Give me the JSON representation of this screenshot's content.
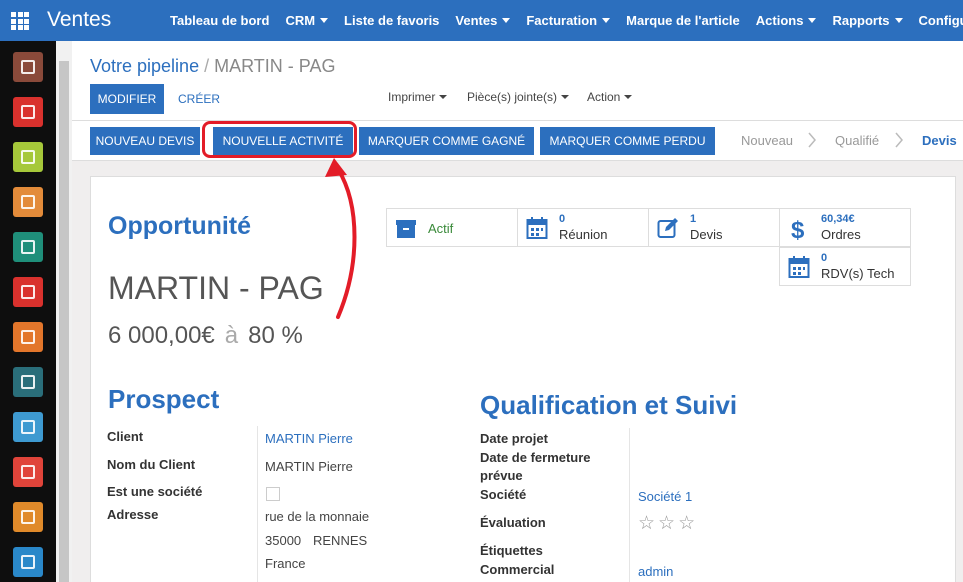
{
  "app": {
    "title": "Ventes"
  },
  "menu": [
    {
      "label": "Tableau de bord",
      "caret": false
    },
    {
      "label": "CRM",
      "caret": true
    },
    {
      "label": "Liste de favoris",
      "caret": false
    },
    {
      "label": "Ventes",
      "caret": true
    },
    {
      "label": "Facturation",
      "caret": true
    },
    {
      "label": "Marque de l'article",
      "caret": false
    },
    {
      "label": "Actions",
      "caret": true
    },
    {
      "label": "Rapports",
      "caret": true
    },
    {
      "label": "Configuration",
      "caret": false
    }
  ],
  "sidebar_apps": [
    {
      "icon": "discuss-icon",
      "color": "#8a4a3a"
    },
    {
      "icon": "mail-icon",
      "color": "#d9312d"
    },
    {
      "icon": "calendar-icon",
      "color": "#a6c83a"
    },
    {
      "icon": "location-pin-icon",
      "color": "#e38b3a"
    },
    {
      "icon": "contacts-icon",
      "color": "#1f8f7a"
    },
    {
      "icon": "folder-icon",
      "color": "#d9312d"
    },
    {
      "icon": "chart-icon",
      "color": "#e3762b"
    },
    {
      "icon": "spreadsheet-icon",
      "color": "#2a6e7a"
    },
    {
      "icon": "card-icon",
      "color": "#3e9ad1"
    },
    {
      "icon": "building-icon",
      "color": "#e0443a"
    },
    {
      "icon": "document-icon",
      "color": "#e08a2a"
    },
    {
      "icon": "puzzle-icon",
      "color": "#2a88c9"
    }
  ],
  "breadcrumb": {
    "parent": "Votre pipeline",
    "separator": "/",
    "current": "MARTIN - PAG"
  },
  "actions": {
    "edit": "MODIFIER",
    "create": "CRÉER",
    "print": "Imprimer",
    "attachments": "Pièce(s) jointe(s)",
    "action": "Action"
  },
  "statusbar": {
    "buttons": [
      "NOUVEAU DEVIS",
      "NOUVELLE ACTIVITÉ",
      "MARQUER COMME GAGNÉ",
      "MARQUER COMME PERDU"
    ],
    "stages": [
      "Nouveau",
      "Qualifié",
      "Devis"
    ],
    "active_stage": "Devis"
  },
  "stat_buttons": [
    {
      "number": "",
      "label": "Actif",
      "icon": "archive-icon"
    },
    {
      "number": "0",
      "label": "Réunion",
      "icon": "calendar-icon"
    },
    {
      "number": "1",
      "label": "Devis",
      "icon": "edit-icon"
    },
    {
      "number": "60,34€",
      "label": "Ordres",
      "icon": "dollar-icon"
    },
    {
      "number": "0",
      "label": "RDV(s) Tech",
      "icon": "calendar-icon"
    }
  ],
  "opportunity": {
    "heading": "Opportunité",
    "name": "MARTIN - PAG",
    "expected_revenue": "6 000,00€",
    "at": "à",
    "probability": "80 %"
  },
  "prospect": {
    "heading": "Prospect",
    "fields": {
      "client_label": "Client",
      "client_value": "MARTIN Pierre",
      "client_name_label": "Nom du Client",
      "client_name_value": "MARTIN Pierre",
      "is_company_label": "Est une société",
      "is_company_value": false,
      "address_label": "Adresse",
      "street": "rue de la monnaie",
      "zip": "35000",
      "city": "RENNES",
      "country": "France"
    }
  },
  "qualification": {
    "heading": "Qualification et Suivi",
    "fields": {
      "project_date_label": "Date projet",
      "closing_date_label_1": "Date de fermeture",
      "closing_date_label_2": "prévue",
      "company_label": "Société",
      "company_value": "Société 1",
      "rating_label": "Évaluation",
      "rating_value": "0 / 3",
      "tags_label": "Étiquettes",
      "salesperson_label": "Commercial",
      "salesperson_value": "admin"
    }
  },
  "annotation": {
    "color": "#e31c28"
  }
}
